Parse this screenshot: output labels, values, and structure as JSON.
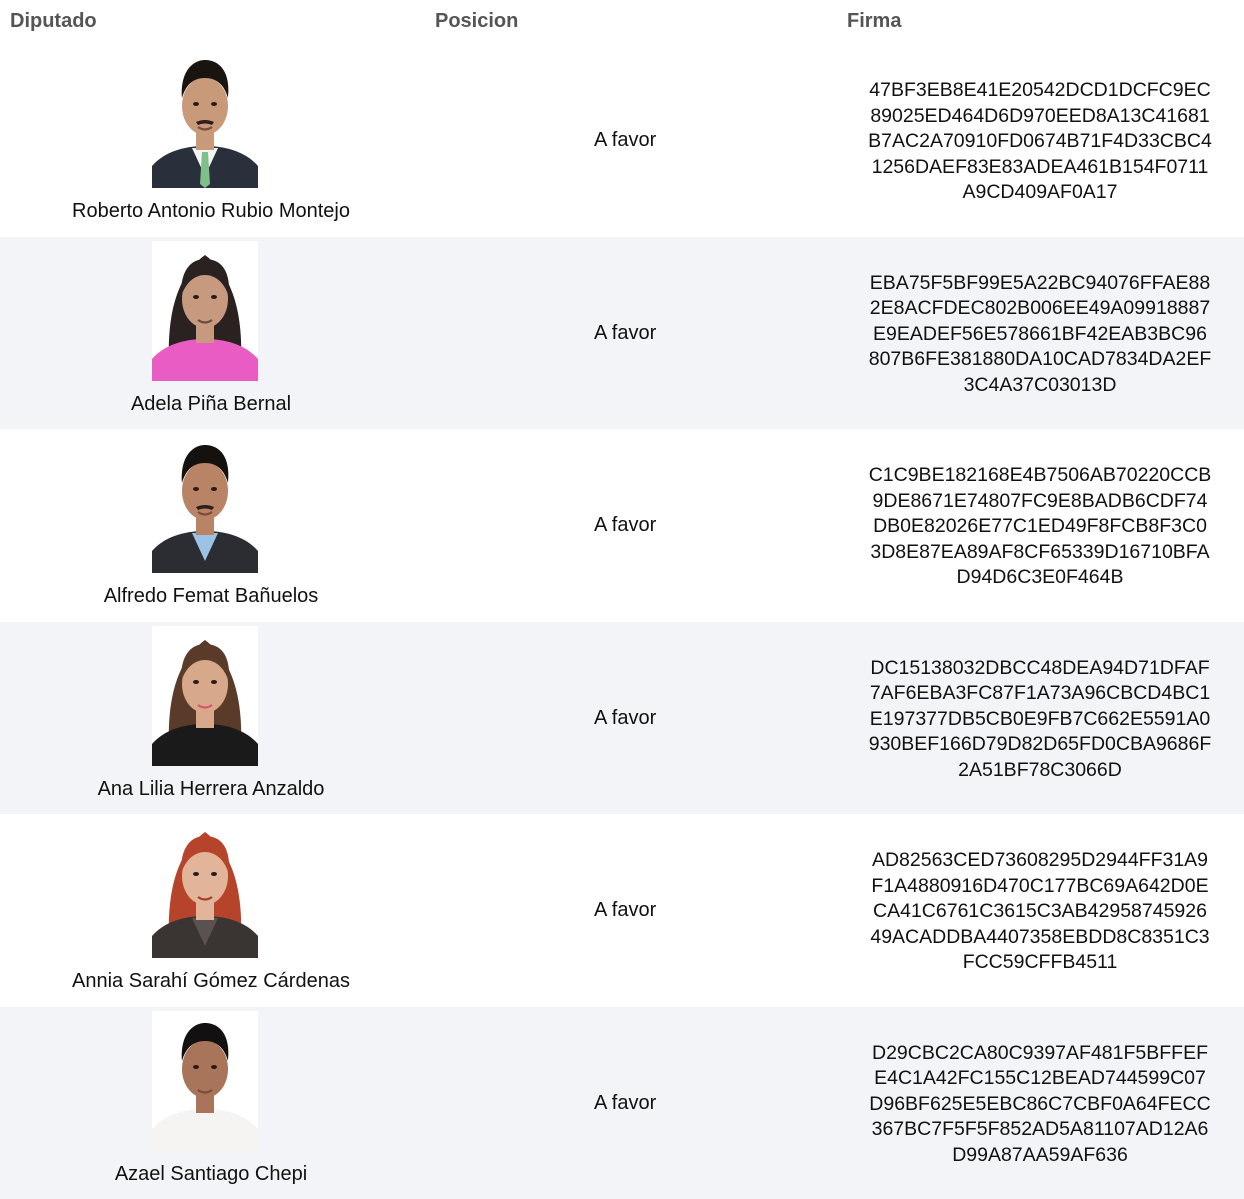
{
  "headers": {
    "diputado": "Diputado",
    "posicion": "Posicion",
    "firma": "Firma"
  },
  "rows": [
    {
      "name": "Roberto Antonio Rubio Montejo",
      "position": "A favor",
      "signature": [
        "47BF3EB8E41E20542DCD1DCFC9EC",
        "89025ED464D6D970EED8A13C41681",
        "B7AC2A70910FD0674B71F4D33CBC4",
        "1256DAEF83E83ADEA461B154F0711",
        "A9CD409AF0A17"
      ],
      "photo": {
        "hair": "#1a1410",
        "skin": "#c99a7a",
        "shirt": "#2a2f3c",
        "collar": "#f4f4f4",
        "accent": "#7fbf8a",
        "bg": "#ffffff"
      }
    },
    {
      "name": "Adela Piña Bernal",
      "position": "A favor",
      "signature": [
        "EBA75F5BF99E5A22BC94076FFAE88",
        "2E8ACFDEC802B006EE49A09918887",
        "E9EADEF56E578661BF42EAB3BC96",
        "807B6FE381880DA10CAD7834DA2EF",
        "3C4A37C03013D"
      ],
      "photo": {
        "hair": "#2a2220",
        "skin": "#c79a80",
        "shirt": "#e85cc3",
        "collar": "#e85cc3",
        "accent": "#6a4a3a",
        "bg": "#ffffff"
      }
    },
    {
      "name": "Alfredo Femat Bañuelos",
      "position": "A favor",
      "signature": [
        "C1C9BE182168E4B7506AB70220CCB",
        "9DE8671E74807FC9E8BADB6CDF74",
        "DB0E82026E77C1ED49F8FCB8F3C0",
        "3D8E87EA89AF8CF65339D16710BFA",
        "D94D6C3E0F464B"
      ],
      "photo": {
        "hair": "#15110f",
        "skin": "#b98466",
        "shirt": "#2b2d33",
        "collar": "#9cc3e6",
        "accent": "#3a3a3a",
        "bg": "#ffffff"
      }
    },
    {
      "name": "Ana Lilia Herrera Anzaldo",
      "position": "A favor",
      "signature": [
        "DC15138032DBCC48DEA94D71DFAF",
        "7AF6EBA3FC87F1A73A96CBCD4BC1",
        "E197377DB5CB0E9FB7C662E5591A0",
        "930BEF166D79D82D65FD0CBA9686F",
        "2A51BF78C3066D"
      ],
      "photo": {
        "hair": "#5a3a28",
        "skin": "#d8a88a",
        "shirt": "#1a1a1a",
        "collar": "#1a1a1a",
        "accent": "#d4566a",
        "bg": "#ffffff"
      }
    },
    {
      "name": "Annia Sarahí Gómez Cárdenas",
      "position": "A favor",
      "signature": [
        "AD82563CED73608295D2944FF31A9",
        "F1A4880916D470C177BC69A642D0E",
        "CA41C6761C3615C3AB42958745926",
        "49ACADDBA4407358EBDD8C8351C3",
        "FCC59CFFB4511"
      ],
      "photo": {
        "hair": "#b5442a",
        "skin": "#e2b49a",
        "shirt": "#3a3432",
        "collar": "#5a5250",
        "accent": "#a83a2a",
        "bg": "#ffffff"
      }
    },
    {
      "name": "Azael Santiago Chepi",
      "position": "A favor",
      "signature": [
        "D29CBC2CA80C9397AF481F5BFFEF",
        "E4C1A42FC155C12BEAD744599C07",
        "D96BF625E5EBC86C7CBF0A64FECC",
        "367BC7F5F5F852AD5A81107AD12A6",
        "D99A87AA59AF636"
      ],
      "photo": {
        "hair": "#121010",
        "skin": "#a8745a",
        "shirt": "#f6f4f2",
        "collar": "#f6f4f2",
        "accent": "#c05a6a",
        "bg": "#ffffff"
      }
    }
  ]
}
